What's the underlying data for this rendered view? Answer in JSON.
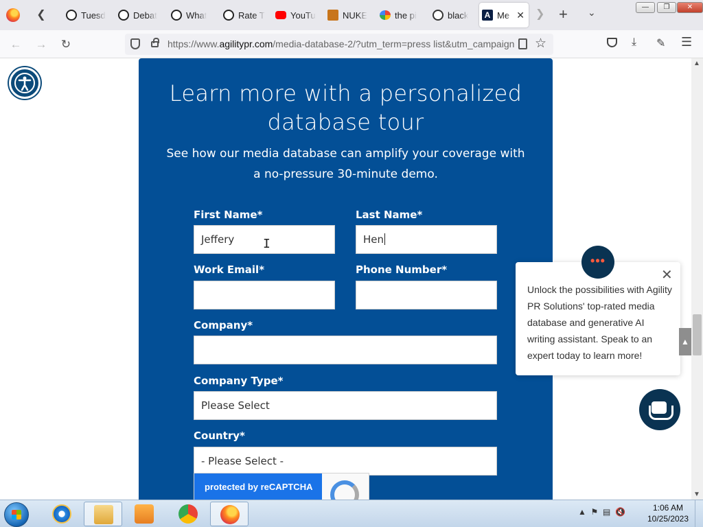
{
  "browser": {
    "tabs": [
      {
        "label": "Tuesd",
        "icon": "web-icon",
        "color": "#222222"
      },
      {
        "label": "Debat",
        "icon": "web-icon",
        "color": "#222222"
      },
      {
        "label": "What",
        "icon": "web-icon",
        "color": "#222222"
      },
      {
        "label": "Rate T",
        "icon": "web-icon",
        "color": "#222222"
      },
      {
        "label": "YouTu",
        "icon": "youtube-icon",
        "color": "#ff0000"
      },
      {
        "label": "NUKE",
        "icon": "nuke-icon",
        "color": "#c8751b"
      },
      {
        "label": "the pi",
        "icon": "google-icon",
        "color": "#4285f4"
      },
      {
        "label": "black",
        "icon": "globe-icon",
        "color": "#333333"
      },
      {
        "label": "Me",
        "icon": "agility-icon",
        "color": "#0a1f44",
        "active": true
      }
    ],
    "url": {
      "prefix": "https://www.",
      "domain": "agilitypr.com",
      "path": "/media-database-2/?utm_term=press list&utm_campaign="
    }
  },
  "page": {
    "title": "Learn more with a personalized database tour",
    "subtitle": "See how our media database can amplify your coverage with a no-pressure 30-minute demo.",
    "form": {
      "first_name_label": "First Name*",
      "first_name_value": "Jeffery",
      "last_name_label": "Last Name*",
      "last_name_value": "Hen",
      "work_email_label": "Work Email*",
      "work_email_value": "",
      "phone_label": "Phone Number*",
      "phone_value": "",
      "company_label": "Company*",
      "company_value": "",
      "company_type_label": "Company Type*",
      "company_type_value": "Please Select",
      "country_label": "Country*",
      "country_value": "- Please Select -"
    },
    "recaptcha_text": "protected by reCAPTCHA",
    "chat": {
      "dots": "•••",
      "message": "Unlock the possibilities with Agility PR Solutions' top-rated media database and generative AI writing assistant. Speak to an expert today to learn more!",
      "close": "✕"
    },
    "accent_color": "#034f96"
  },
  "taskbar": {
    "time": "1:06 AM",
    "date": "10/25/2023"
  }
}
